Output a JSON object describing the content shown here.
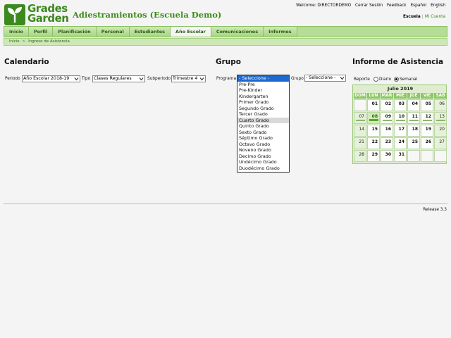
{
  "brand": {
    "line1": "Grades",
    "line2": "Garden"
  },
  "header": {
    "school_title": "Adiestramientos (Escuela Demo)",
    "welcome": "Welcome: DIRECTORDEMO",
    "logout": "Cerrar Sesión",
    "feedback": "Feedback",
    "lang_es": "Español",
    "lang_en": "English",
    "escuela": "Escuela",
    "mi_cuenta": "Mi Cuenta"
  },
  "nav": {
    "tabs": [
      "Inicio",
      "Perfil",
      "Planificación",
      "Personal",
      "Estudiantes",
      "Año Escolar",
      "Comunicaciones",
      "Informes"
    ],
    "active": "Año Escolar"
  },
  "breadcrumb": {
    "home": "Inicio",
    "sep": ">",
    "current": "Ingreso de Asistencia"
  },
  "calendario": {
    "title": "Calendario",
    "periodo_label": "Periodo",
    "periodo_value": "Año Escolar 2018-19",
    "tipo_label": "Tipo",
    "tipo_value": "Clases Regulares",
    "subperiodo_label": "Subperiodo",
    "subperiodo_value": "Trimestre 4"
  },
  "grupo": {
    "title": "Grupo",
    "programa_label": "Programa",
    "programa_value": "- Seleccione -",
    "grupo_label": "Grupo",
    "grupo_value": "- Seleccione -",
    "options": [
      "- Seleccione -",
      "Pre-Pre",
      "Pre-Kinder",
      "Kindergarten",
      "Primer Grado",
      "Segundo Grado",
      "Tercer Grado",
      "Cuarto Grado",
      "Quinto Grado",
      "Sexto Grado",
      "Séptimo Grado",
      "Octavo Grado",
      "Noveno Grado",
      "Decimo Grado",
      "Undécimo Grado",
      "Duodécimo Grado"
    ],
    "highlighted": "- Seleccione -",
    "hovered": "Cuarto Grado"
  },
  "informe": {
    "title": "Informe de Asistencia",
    "reporte_label": "Reporte",
    "diario": "Diario",
    "semanal": "Semanal",
    "selected": "Semanal",
    "month": "Julio 2019",
    "dow": [
      "DOM",
      "LUN",
      "MAR",
      "MIÉ",
      "JUE",
      "VIE",
      "SÁB"
    ],
    "weeks": [
      [
        "",
        "01",
        "02",
        "03",
        "04",
        "05",
        "06"
      ],
      [
        "07",
        "08",
        "09",
        "10",
        "11",
        "12",
        "13"
      ],
      [
        "14",
        "15",
        "16",
        "17",
        "18",
        "19",
        "20"
      ],
      [
        "21",
        "22",
        "23",
        "24",
        "25",
        "26",
        "27"
      ],
      [
        "28",
        "29",
        "30",
        "31",
        "",
        "",
        ""
      ]
    ],
    "today": "08",
    "marked_week": 1
  },
  "footer": {
    "release": "Release 3.3"
  }
}
